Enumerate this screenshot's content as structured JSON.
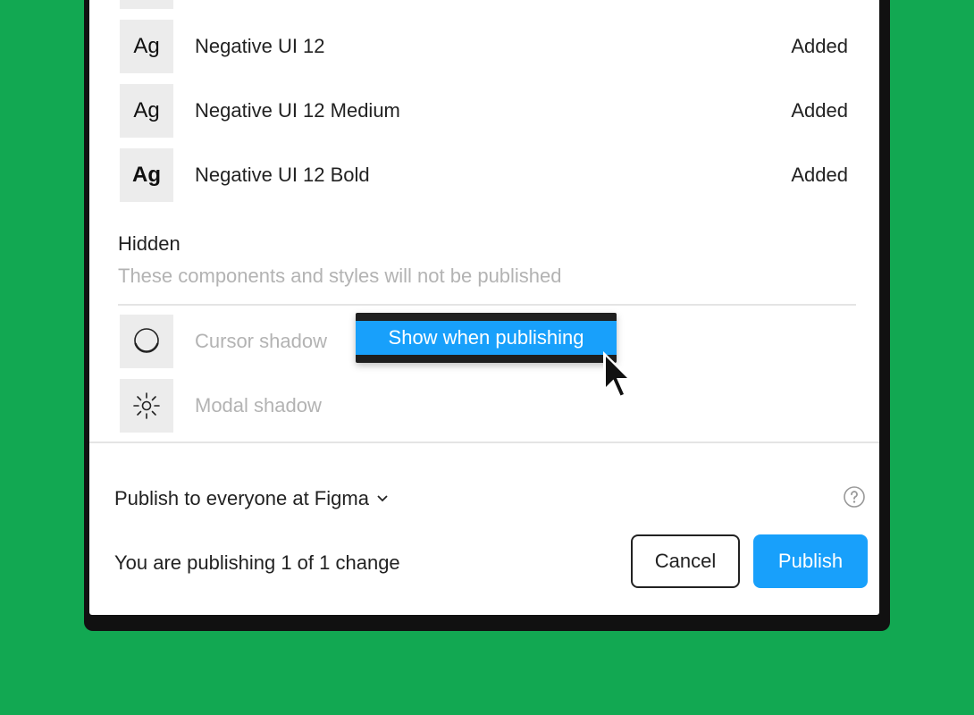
{
  "font_list": {
    "items": [
      {
        "thumb": "Ag",
        "name": "Negative UI 12",
        "status": "Added"
      },
      {
        "thumb": "Ag",
        "name": "Negative UI 12 Medium",
        "status": "Added"
      },
      {
        "thumb": "Ag",
        "name": "Negative UI 12 Bold",
        "status": "Added"
      }
    ]
  },
  "hidden_section": {
    "title": "Hidden",
    "description": "These components and styles will not be published",
    "items": [
      {
        "name": "Cursor shadow",
        "icon": "circle-shadow-icon"
      },
      {
        "name": "Modal shadow",
        "icon": "sun-icon"
      }
    ]
  },
  "context_menu": {
    "item": "Show when publishing"
  },
  "footer": {
    "publish_target": "Publish to everyone at Figma",
    "summary": "You are publishing 1 of 1 change",
    "cancel_label": "Cancel",
    "publish_label": "Publish",
    "help_icon": "help-icon"
  },
  "colors": {
    "background": "#12a852",
    "accent": "#18a0fb",
    "menu_bg": "#1e1e1e"
  }
}
